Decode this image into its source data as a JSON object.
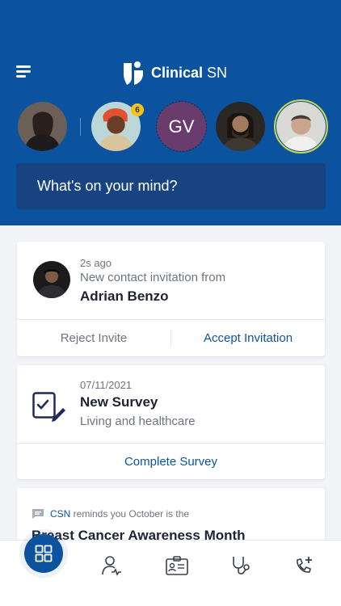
{
  "app": {
    "brand_strong": "Clinical",
    "brand_light": " SN"
  },
  "stories": [
    {
      "id": "story-1"
    },
    {
      "id": "story-2",
      "badge": "6"
    },
    {
      "id": "story-3",
      "initials": "GV"
    },
    {
      "id": "story-4"
    },
    {
      "id": "story-5"
    }
  ],
  "composer": {
    "placeholder": "What's on your mind?"
  },
  "invitation_card": {
    "time": "2s ago",
    "message": "New contact invitation from",
    "name": "Adrian Benzo",
    "reject_label": "Reject Invite",
    "accept_label": "Accept Invitation"
  },
  "survey_card": {
    "date": "07/11/2021",
    "title": "New Survey",
    "subtitle": "Living and healthcare",
    "action_label": "Complete Survey"
  },
  "reminder_card": {
    "source": "CSN",
    "message": " reminds you October is the",
    "title": "Breast Cancer Awareness Month"
  },
  "colors": {
    "brand": "#0c539f",
    "composer": "#174380",
    "accent_text": "#0c539f",
    "active_ring": "#c9d84a",
    "badge": "#f4c31a"
  },
  "bottom_nav": [
    {
      "icon": "dashboard-icon",
      "active": true
    },
    {
      "icon": "doctor-profile-icon"
    },
    {
      "icon": "id-card-icon"
    },
    {
      "icon": "stethoscope-icon"
    },
    {
      "icon": "phone-add-icon"
    }
  ]
}
